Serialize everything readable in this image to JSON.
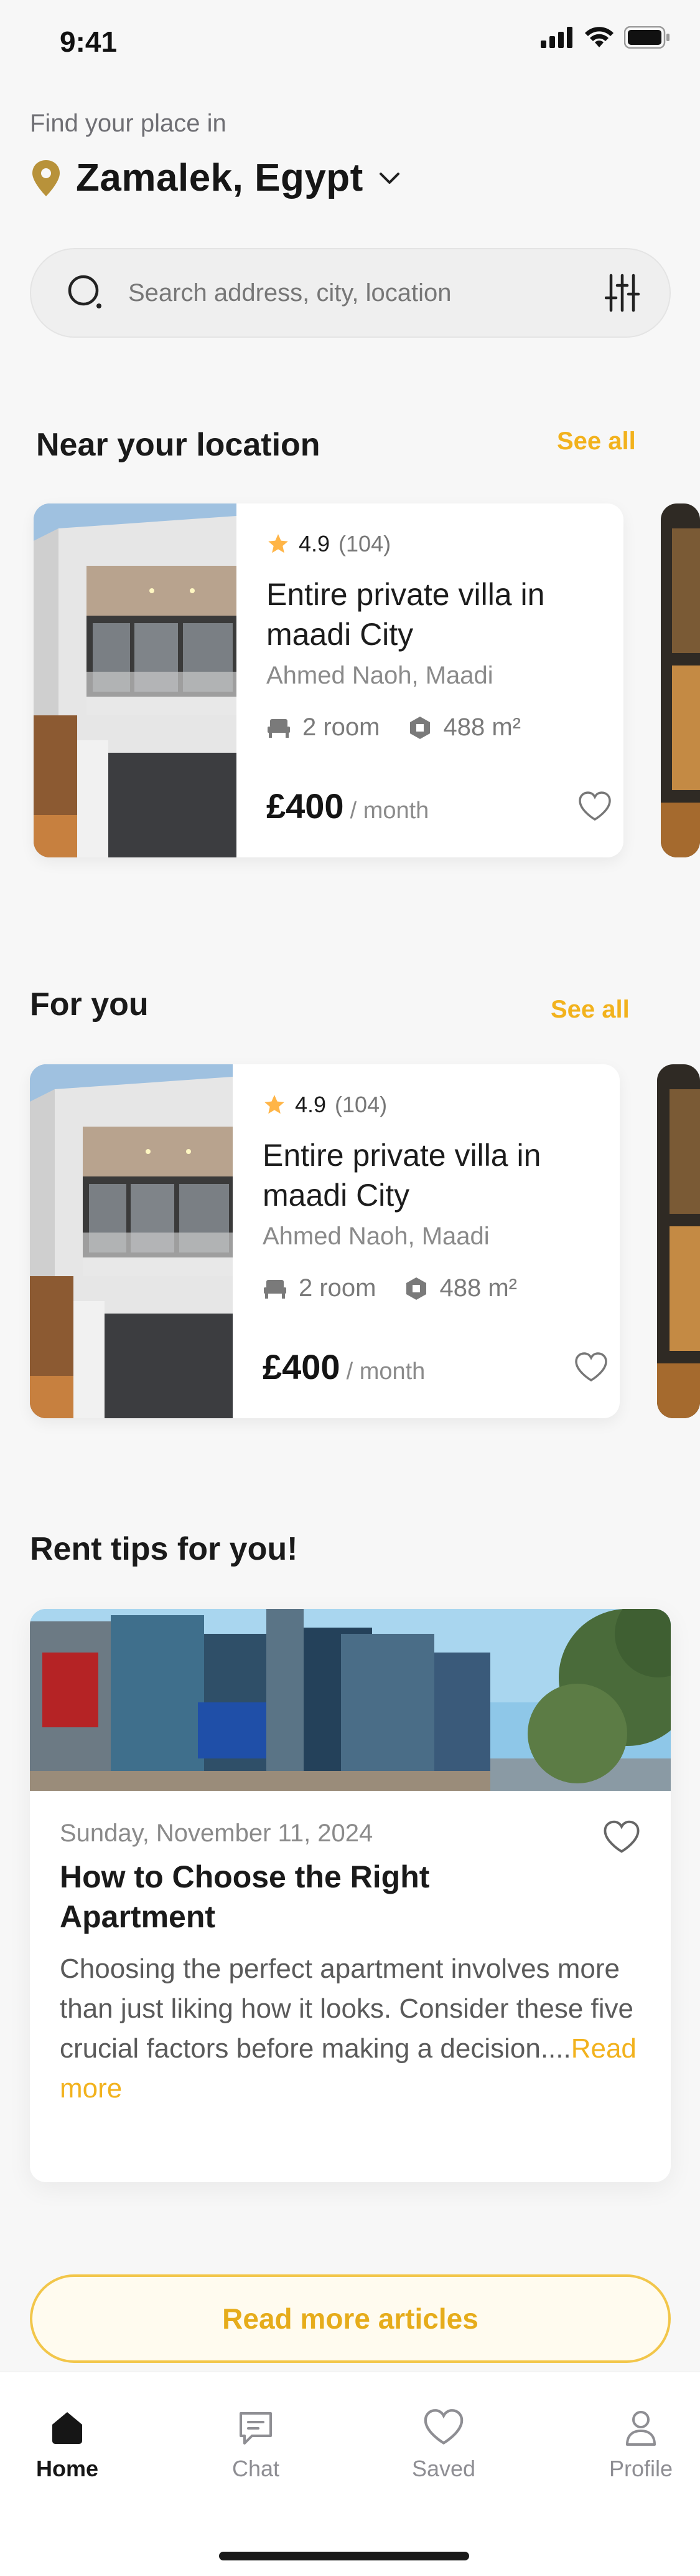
{
  "status": {
    "time": "9:41"
  },
  "location": {
    "label": "Find your place in",
    "name": "Zamalek, Egypt"
  },
  "search": {
    "placeholder": "Search address, city, location"
  },
  "near": {
    "title": "Near your location",
    "see_all": "See all",
    "card": {
      "rating": "4.9",
      "reviews": "(104)",
      "title": "Entire private villa in maadi City",
      "subtitle": "Ahmed Naoh, Maadi",
      "rooms": "2 room",
      "area": "488 m²",
      "price": "£400",
      "period": "/ month"
    }
  },
  "for_you": {
    "title": "For you",
    "see_all": "See all",
    "card": {
      "rating": "4.9",
      "reviews": "(104)",
      "title": "Entire private villa in maadi City",
      "subtitle": "Ahmed Naoh, Maadi",
      "rooms": "2 room",
      "area": "488 m²",
      "price": "£400",
      "period": "/ month"
    }
  },
  "tips": {
    "title": "Rent tips for you!",
    "article": {
      "date": "Sunday, November 11, 2024",
      "title": "How to Choose the Right Apartment",
      "excerpt": "Choosing the perfect apartment involves more than just liking how it looks. Consider these five crucial factors before making a decision....",
      "read_more": "Read more"
    },
    "more_button": "Read more articles"
  },
  "nav": {
    "items": [
      {
        "label": "Home",
        "icon": "home-icon",
        "active": true
      },
      {
        "label": "Chat",
        "icon": "chat-icon",
        "active": false
      },
      {
        "label": "Saved",
        "icon": "heart-icon",
        "active": false
      },
      {
        "label": "Profile",
        "icon": "profile-icon",
        "active": false
      }
    ]
  },
  "colors": {
    "accent": "#f2b21d",
    "star": "#ffb547",
    "pin": "#b8923a"
  }
}
